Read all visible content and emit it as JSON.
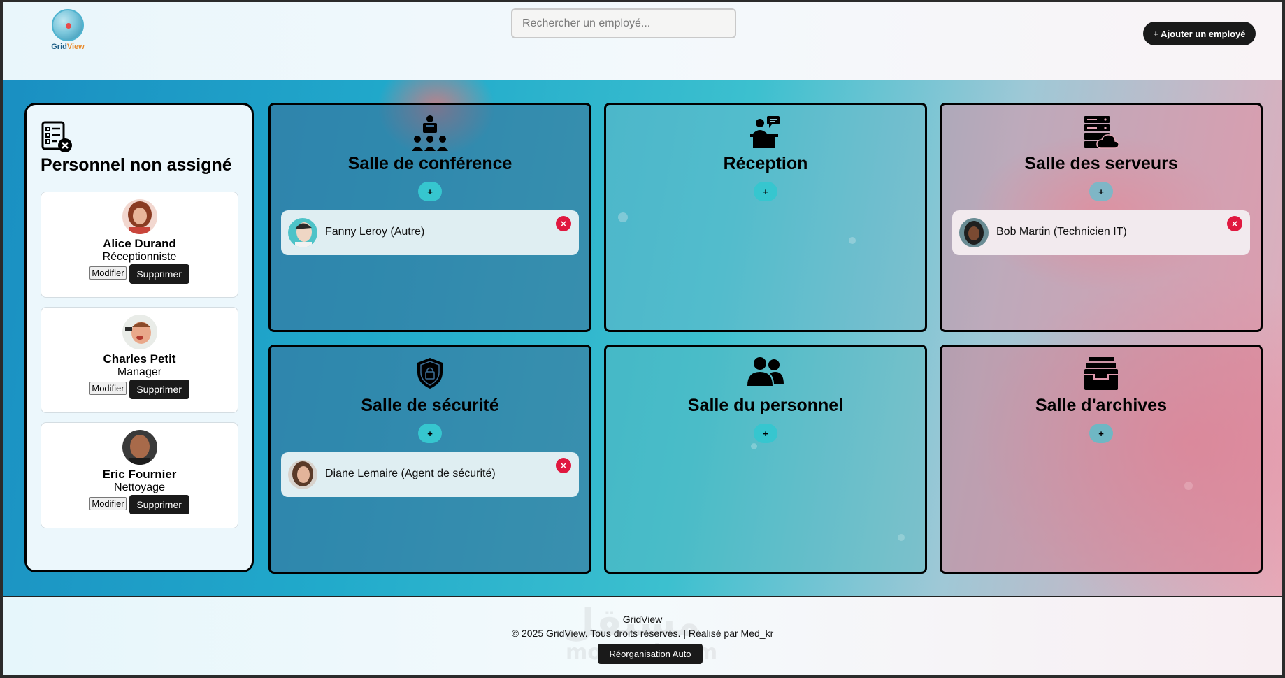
{
  "header": {
    "logo_text": "GridView",
    "search_placeholder": "Rechercher un employé...",
    "add_button": "+ Ajouter un employé"
  },
  "sidebar": {
    "title": "Personnel non assigné",
    "employees": [
      {
        "name": "Alice Durand",
        "role": "Réceptionniste",
        "edit": "Modifier",
        "delete": "Supprimer"
      },
      {
        "name": "Charles Petit",
        "role": "Manager",
        "edit": "Modifier",
        "delete": "Supprimer"
      },
      {
        "name": "Eric Fournier",
        "role": "Nettoyage",
        "edit": "Modifier",
        "delete": "Supprimer"
      }
    ]
  },
  "rooms": [
    {
      "title": "Salle de conférence",
      "icon": "conference-icon",
      "add": "+",
      "assigned": [
        "Fanny Leroy (Autre)"
      ]
    },
    {
      "title": "Réception",
      "icon": "reception-icon",
      "add": "+",
      "assigned": []
    },
    {
      "title": "Salle des serveurs",
      "icon": "server-icon",
      "add": "+",
      "assigned": [
        "Bob Martin (Technicien IT)"
      ]
    },
    {
      "title": "Salle de sécurité",
      "icon": "shield-lock-icon",
      "add": "+",
      "assigned": [
        "Diane Lemaire (Agent de sécurité)"
      ]
    },
    {
      "title": "Salle du personnel",
      "icon": "users-icon",
      "add": "+",
      "assigned": []
    },
    {
      "title": "Salle d'archives",
      "icon": "archive-icon",
      "add": "+",
      "assigned": []
    }
  ],
  "remove_label": "×",
  "footer": {
    "brand": "GridView",
    "copyright": "© 2025 GridView. Tous droits réservés. | Réalisé par Med_kr",
    "reorganize": "Réorganisation Auto"
  },
  "colors": {
    "accent_add": "#36c6cf",
    "remove": "#e0183f",
    "dark_button": "#1a1a1a"
  }
}
